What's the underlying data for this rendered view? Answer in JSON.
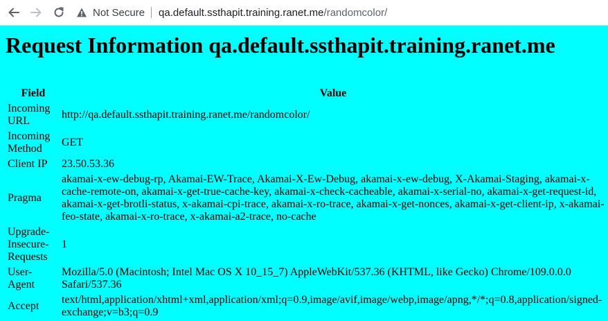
{
  "browser": {
    "security_label": "Not Secure",
    "url_host": "qa.default.ssthapit.training.ranet.me",
    "url_path": "/randomcolor/"
  },
  "page": {
    "title": "Request Information qa.default.ssthapit.training.ranet.me",
    "background": "#00ffff"
  },
  "table": {
    "headers": [
      "Field",
      "Value"
    ],
    "rows": [
      {
        "field": "Incoming URL",
        "value": "http://qa.default.ssthapit.training.ranet.me/randomcolor/"
      },
      {
        "field": "Incoming Method",
        "value": "GET"
      },
      {
        "field": "Client IP",
        "value": "23.50.53.36"
      },
      {
        "field": "Pragma",
        "value": "akamai-x-ew-debug-rp, Akamai-EW-Trace, Akamai-X-Ew-Debug, akamai-x-ew-debug, X-Akamai-Staging, akamai-x-cache-remote-on, akamai-x-get-true-cache-key, akamai-x-check-cacheable, akamai-x-serial-no, akamai-x-get-request-id, akamai-x-get-brotli-status, x-akamai-cpi-trace, akamai-x-ro-trace, akamai-x-get-nonces, akamai-x-get-client-ip, x-akamai-feo-state, akamai-x-ro-trace, x-akamai-a2-trace, no-cache"
      },
      {
        "field": "Upgrade-Insecure-Requests",
        "value": "1"
      },
      {
        "field": "User-Agent",
        "value": "Mozilla/5.0 (Macintosh; Intel Mac OS X 10_15_7) AppleWebKit/537.36 (KHTML, like Gecko) Chrome/109.0.0.0 Safari/537.36"
      },
      {
        "field": "Accept",
        "value": "text/html,application/xhtml+xml,application/xml;q=0.9,image/avif,image/webp,image/apng,*/*;q=0.8,application/signed-exchange;v=b3;q=0.9"
      }
    ]
  }
}
